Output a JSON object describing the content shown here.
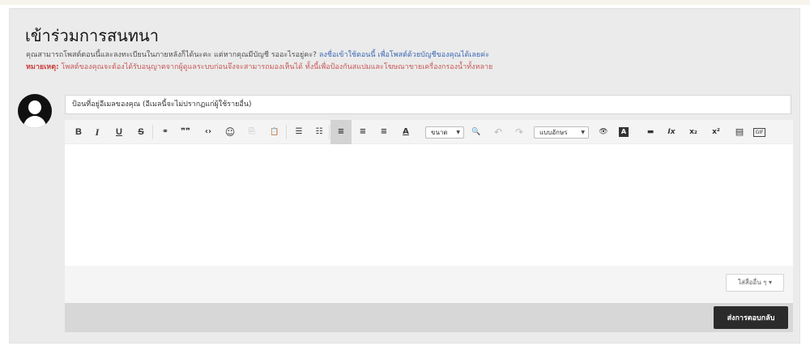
{
  "page": {
    "title": "เข้าร่วมการสนทนา",
    "info_text": "คุณสามารถโพสต์ตอนนี้และลงทะเบียนในภายหลังก็ได้นะคะ แต่หากคุณมีบัญชี รออะไรอยู่คะ? ",
    "info_link": "ลงชื่อเข้าใช้ตอนนี้ เพื่อโพสต์ด้วยบัญชีของคุณได้เลยค่ะ",
    "note_label": "หมายเหตุ:",
    "note_text": " โพสต์ของคุณจะต้องได้รับอนุญาตจากผู้ดูแลระบบก่อนจึงจะสามารถมองเห็นได้ ทั้งนี้เพื่อป้องกันสแปมและโฆษณาขายเครื่องกรองน้ำทั้งหลาย"
  },
  "email": {
    "placeholder": "ป้อนที่อยู่อีเมลของคุณ (อีเมลนี้จะไม่ปรากฏแก่ผู้ใช้รายอื่น)",
    "value": ""
  },
  "toolbar": {
    "bold": "B",
    "italic": "I",
    "underline": "U",
    "strike": "S",
    "link": "⚭",
    "quote": "❞❞",
    "code": "‹›",
    "emoji": "☺",
    "copy": "⎘",
    "paste": "📋",
    "bullets": "☰",
    "numbers": "☷",
    "align_left": "≡",
    "align_center": "≡",
    "align_right": "≡",
    "font_color": "A",
    "size_label": "ขนาด",
    "find": "🔍",
    "undo": "↶",
    "redo": "↷",
    "format_label": "แบบอักษร",
    "preview": "👁",
    "bg_color": "A",
    "hr": "▬",
    "clear": "Ix",
    "subscript": "x₂",
    "superscript": "x²",
    "source": "▤",
    "gif": "GIF"
  },
  "icons": {
    "link": "link-icon",
    "quote": "quote-icon",
    "code": "code-icon",
    "emoji": "emoji-icon",
    "copy": "copy-icon",
    "paste": "paste-icon",
    "find": "find-replace-icon",
    "preview": "preview-eye-icon",
    "source": "source-icon",
    "gif": "gif-icon"
  },
  "editor": {
    "content": "",
    "insert_other_label": "ใส่สื่ออื่น ๆ ▾",
    "submit_label": "ส่งการตอบกลับ"
  },
  "colors": {
    "link": "#3b69b6",
    "note": "#c85858",
    "submit_bg": "#2b2b2b"
  }
}
